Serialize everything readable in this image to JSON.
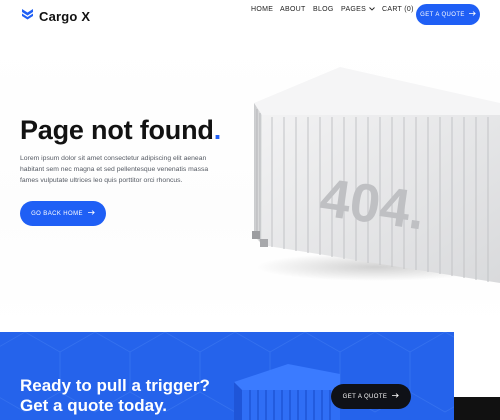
{
  "brand": {
    "name": "Cargo X"
  },
  "nav": {
    "home": "HOME",
    "about": "ABOUT",
    "blog": "BLOG",
    "pages": "PAGES",
    "cart": "CART (0)",
    "quote_button": "GET A QUOTE"
  },
  "hero": {
    "title": "Page not found",
    "title_dot": ".",
    "description": "Lorem ipsum dolor sit amet consectetur adipiscing elit aenean habitant sem nec magna et sed pellentesque venenatis massa fames vulputate ultrices leo quis porttitor orci rhoncus.",
    "button": "GO BACK HOME",
    "container_text": "404."
  },
  "cta": {
    "line1": "Ready to pull a trigger?",
    "line2": "Get a quote today.",
    "button": "GET A QUOTE"
  },
  "colors": {
    "accent": "#1f5ff5",
    "cta_background": "#2563eb",
    "dark_button": "#0f1117"
  },
  "icons": {
    "logo": "chevron-stack-logo-icon",
    "arrow": "arrow-right-icon",
    "dropdown": "chevron-down-icon"
  }
}
